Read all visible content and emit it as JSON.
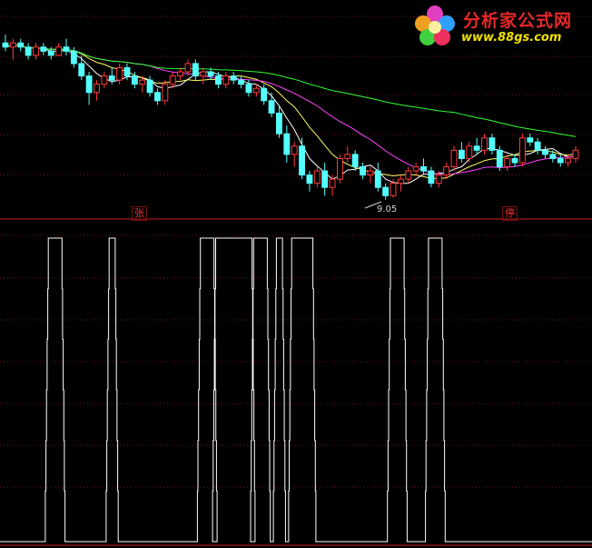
{
  "logo": {
    "brand": "分析家公式网",
    "url": "www.88gs.com"
  },
  "markers": {
    "rise": "张",
    "stop": "停"
  },
  "chart_data": [
    {
      "type": "candlestick",
      "panel": "top",
      "ylim": [
        8.6,
        13.4
      ],
      "colors": {
        "up": "#ff3b3b",
        "down": "#54ffff",
        "ma5": "#ffffff",
        "ma10": "#ffff66",
        "ma20": "#ff44ff",
        "ma60": "#33ff33"
      },
      "price_note": "9.05",
      "ohlc": [
        [
          12.8,
          13.0,
          12.6,
          12.7
        ],
        [
          12.7,
          12.9,
          12.4,
          12.8
        ],
        [
          12.8,
          12.9,
          12.6,
          12.7
        ],
        [
          12.7,
          12.8,
          12.4,
          12.5
        ],
        [
          12.5,
          12.8,
          12.4,
          12.7
        ],
        [
          12.7,
          12.8,
          12.5,
          12.6
        ],
        [
          12.6,
          12.7,
          12.4,
          12.5
        ],
        [
          12.5,
          12.8,
          12.5,
          12.7
        ],
        [
          12.7,
          12.9,
          12.5,
          12.6
        ],
        [
          12.6,
          12.7,
          12.2,
          12.3
        ],
        [
          12.3,
          12.5,
          11.9,
          12.0
        ],
        [
          12.0,
          12.1,
          11.3,
          11.6
        ],
        [
          11.6,
          11.9,
          11.4,
          11.8
        ],
        [
          11.8,
          12.1,
          11.7,
          12.0
        ],
        [
          12.0,
          12.2,
          11.8,
          11.9
        ],
        [
          11.9,
          12.3,
          11.8,
          12.2
        ],
        [
          12.2,
          12.3,
          11.9,
          12.0
        ],
        [
          12.0,
          12.1,
          11.7,
          11.8
        ],
        [
          11.8,
          12.0,
          11.6,
          11.9
        ],
        [
          11.9,
          12.0,
          11.5,
          11.6
        ],
        [
          11.6,
          11.7,
          11.3,
          11.4
        ],
        [
          11.4,
          11.9,
          11.3,
          11.8
        ],
        [
          11.8,
          12.1,
          11.7,
          12.0
        ],
        [
          12.0,
          12.2,
          11.9,
          12.1
        ],
        [
          12.1,
          12.4,
          12.0,
          12.3
        ],
        [
          12.3,
          12.4,
          11.9,
          12.0
        ],
        [
          12.0,
          12.2,
          11.8,
          12.1
        ],
        [
          12.1,
          12.2,
          11.9,
          12.0
        ],
        [
          12.0,
          12.1,
          11.7,
          11.8
        ],
        [
          11.8,
          12.1,
          11.7,
          12.0
        ],
        [
          12.0,
          12.1,
          11.8,
          11.9
        ],
        [
          11.9,
          12.0,
          11.7,
          11.8
        ],
        [
          11.8,
          11.9,
          11.5,
          11.6
        ],
        [
          11.6,
          11.8,
          11.5,
          11.7
        ],
        [
          11.7,
          11.8,
          11.3,
          11.4
        ],
        [
          11.4,
          11.6,
          11.0,
          11.1
        ],
        [
          11.1,
          11.3,
          10.5,
          10.6
        ],
        [
          10.6,
          10.8,
          9.9,
          10.1
        ],
        [
          10.1,
          10.4,
          9.8,
          10.3
        ],
        [
          10.3,
          10.5,
          9.5,
          9.6
        ],
        [
          9.6,
          9.7,
          9.2,
          9.4
        ],
        [
          9.4,
          9.8,
          9.3,
          9.7
        ],
        [
          9.7,
          9.9,
          9.1,
          9.3
        ],
        [
          9.3,
          9.6,
          9.1,
          9.5
        ],
        [
          9.5,
          10.1,
          9.4,
          10.0
        ],
        [
          10.0,
          10.3,
          9.9,
          10.1
        ],
        [
          10.1,
          10.2,
          9.7,
          9.8
        ],
        [
          9.8,
          9.9,
          9.5,
          9.6
        ],
        [
          9.6,
          9.8,
          9.4,
          9.7
        ],
        [
          9.7,
          9.9,
          9.2,
          9.3
        ],
        [
          9.3,
          9.4,
          9.0,
          9.1
        ],
        [
          9.1,
          9.5,
          9.05,
          9.4
        ],
        [
          9.4,
          9.6,
          9.2,
          9.5
        ],
        [
          9.5,
          9.8,
          9.4,
          9.7
        ],
        [
          9.7,
          9.9,
          9.6,
          9.8
        ],
        [
          9.8,
          10.0,
          9.6,
          9.7
        ],
        [
          9.7,
          9.8,
          9.3,
          9.4
        ],
        [
          9.4,
          9.7,
          9.3,
          9.6
        ],
        [
          9.6,
          9.9,
          9.5,
          9.8
        ],
        [
          9.8,
          10.3,
          9.7,
          10.2
        ],
        [
          10.2,
          10.4,
          9.9,
          10.0
        ],
        [
          10.0,
          10.4,
          9.9,
          10.3
        ],
        [
          10.3,
          10.5,
          10.1,
          10.2
        ],
        [
          10.2,
          10.6,
          10.1,
          10.5
        ],
        [
          10.5,
          10.6,
          10.1,
          10.2
        ],
        [
          10.2,
          10.3,
          9.7,
          9.8
        ],
        [
          9.8,
          10.1,
          9.7,
          10.0
        ],
        [
          10.0,
          10.1,
          9.8,
          9.9
        ],
        [
          9.9,
          10.6,
          9.8,
          10.5
        ],
        [
          10.5,
          10.6,
          10.3,
          10.4
        ],
        [
          10.4,
          10.5,
          10.1,
          10.2
        ],
        [
          10.2,
          10.3,
          10.0,
          10.1
        ],
        [
          10.1,
          10.2,
          9.9,
          10.0
        ],
        [
          10.0,
          10.1,
          9.8,
          9.9
        ],
        [
          9.9,
          10.1,
          9.8,
          10.0
        ],
        [
          10.0,
          10.3,
          9.9,
          10.2
        ]
      ]
    },
    {
      "type": "line",
      "panel": "bottom",
      "ylim": [
        0,
        100
      ],
      "color": "#ffffff",
      "values": [
        0,
        0,
        0,
        0,
        0,
        0,
        0,
        0,
        0,
        0,
        0,
        0,
        0,
        0,
        0,
        0,
        0,
        0,
        0,
        0,
        0,
        0,
        0,
        0,
        0,
        0,
        0,
        0,
        0,
        0,
        0,
        0,
        0,
        0,
        0,
        0,
        0,
        0,
        0,
        0,
        0,
        0,
        0,
        0,
        0,
        0,
        0,
        0,
        0,
        0,
        0,
        0,
        0,
        0,
        0,
        0,
        0,
        0,
        0,
        0,
        0,
        0,
        0,
        0,
        0,
        0,
        0,
        0,
        0,
        0,
        0,
        0,
        0,
        0,
        0,
        0,
        0,
        0,
        0,
        0,
        0,
        0,
        0,
        0,
        0,
        0,
        0,
        0,
        0,
        0,
        0,
        0,
        0,
        0,
        0,
        0,
        0,
        0,
        0,
        0,
        0,
        0,
        0,
        0,
        0,
        0,
        0,
        0,
        0,
        0,
        0,
        0,
        0,
        0,
        0,
        0,
        0,
        0,
        0,
        0,
        0,
        0,
        0,
        0,
        0,
        0,
        0,
        0,
        0,
        0,
        0,
        0,
        0,
        0,
        0,
        0,
        0,
        0,
        0,
        0,
        0,
        0,
        0,
        0,
        0,
        0,
        0,
        0,
        0,
        0,
        0,
        0,
        0,
        0,
        0,
        0,
        0,
        0,
        0,
        0,
        0,
        0,
        0,
        0,
        0,
        0,
        0,
        0,
        0,
        0,
        0,
        0,
        0,
        0,
        0,
        0,
        0,
        0,
        0,
        0,
        0,
        0,
        0,
        0,
        0,
        0,
        0,
        0,
        0,
        0,
        0,
        0,
        0,
        0,
        0,
        0,
        0,
        0,
        0,
        0,
        0,
        0,
        0,
        0,
        0,
        0,
        0,
        0,
        0,
        0,
        0,
        0,
        0,
        0,
        0,
        0,
        0,
        0,
        0,
        0,
        0,
        0,
        0,
        0,
        0,
        0,
        0,
        0,
        0,
        0,
        0,
        0,
        0,
        0,
        0,
        0,
        0,
        0,
        0,
        0,
        0,
        0,
        0,
        0,
        0,
        0,
        0,
        0,
        0,
        0,
        0,
        0,
        0,
        0,
        0,
        0,
        0,
        0,
        0,
        0,
        0,
        0,
        0,
        0,
        0,
        0,
        0,
        0,
        0,
        0,
        0,
        0,
        0,
        0,
        0,
        0,
        0,
        0,
        0,
        0,
        0,
        0,
        0,
        0,
        0,
        0,
        0,
        0,
        0,
        0,
        0,
        0,
        0,
        0,
        0,
        0,
        0,
        0,
        0,
        0,
        0,
        0,
        0,
        0,
        0,
        0,
        0,
        0,
        0,
        0,
        0,
        0,
        0,
        0,
        0,
        0,
        0,
        0,
        0,
        0,
        0,
        0,
        0,
        0,
        0,
        0,
        0,
        0,
        0,
        0,
        0,
        0,
        0,
        0,
        0,
        0,
        0,
        0,
        0,
        0,
        0,
        0,
        0,
        0,
        0,
        0,
        0,
        0,
        0,
        0,
        0,
        0,
        0,
        0,
        0,
        0,
        0,
        0,
        0,
        0,
        0,
        0,
        0,
        0,
        0,
        0,
        0,
        0,
        0,
        0,
        0,
        0,
        0,
        0,
        0,
        0,
        0,
        0,
        0,
        0,
        0,
        0,
        0,
        0,
        0,
        0,
        0,
        0,
        0,
        0,
        0,
        0,
        0,
        0,
        0,
        0,
        0,
        0,
        0,
        0,
        0,
        0,
        0,
        0,
        0,
        0,
        0,
        0,
        0,
        0,
        0,
        0,
        0,
        0,
        0,
        0,
        0,
        0,
        0,
        0,
        0,
        0,
        0,
        0,
        0,
        0,
        0,
        0,
        0,
        0,
        0,
        0,
        0,
        0,
        0,
        0,
        0,
        0,
        0,
        0,
        0,
        0,
        0,
        0,
        0,
        0,
        0,
        0,
        0,
        0,
        0,
        0,
        0,
        0,
        0,
        0,
        0,
        0,
        0,
        0,
        0,
        0,
        0,
        0,
        0,
        0,
        0,
        0,
        0,
        0,
        0,
        0,
        0,
        0,
        0,
        0,
        0,
        0,
        0,
        0,
        0,
        0,
        0,
        0,
        0,
        0,
        0,
        0,
        0,
        0,
        0,
        0,
        0,
        0,
        0,
        0,
        0,
        0,
        0,
        0,
        0,
        0,
        0,
        0,
        0,
        0,
        0,
        0,
        0,
        0,
        0,
        0,
        0,
        0,
        0,
        0,
        0,
        0,
        0,
        0,
        0,
        0,
        0,
        0,
        0,
        0,
        0,
        0,
        0,
        0,
        0,
        0,
        0,
        0,
        0,
        0,
        0,
        0,
        0,
        0,
        0,
        0,
        0,
        0,
        0,
        0,
        0,
        0,
        0,
        0,
        0,
        0,
        0,
        0,
        0,
        0,
        0,
        0,
        0,
        0,
        0,
        0,
        0,
        0,
        0,
        0,
        0,
        0,
        0,
        0,
        0,
        0,
        0,
        0,
        0,
        0,
        0,
        0,
        0,
        0,
        0,
        0,
        0,
        0,
        0,
        0,
        0,
        0,
        0,
        0,
        0,
        0,
        0,
        0,
        0,
        0,
        0,
        0,
        0,
        0,
        0,
        0,
        0,
        0,
        0,
        0,
        0,
        0,
        0,
        0,
        0,
        0,
        0,
        0,
        0,
        0,
        0,
        0,
        0,
        0,
        0,
        0,
        0,
        0,
        0,
        0,
        0,
        0,
        0,
        0,
        0,
        0,
        0,
        0,
        0,
        0,
        0,
        0,
        0,
        0,
        0,
        0,
        0,
        0,
        0,
        0,
        0,
        0,
        0,
        0,
        0,
        0,
        0,
        0,
        0,
        0,
        0,
        0,
        0,
        0,
        0,
        0,
        0,
        0,
        0,
        0,
        0,
        0,
        0,
        0,
        0,
        0,
        0,
        0,
        0,
        0,
        0,
        0,
        0,
        0,
        0,
        0,
        0,
        0,
        0,
        0,
        0,
        0,
        0,
        0,
        0,
        0,
        0,
        0,
        0,
        0,
        0,
        0,
        0,
        0,
        0,
        0,
        0,
        0,
        0,
        0,
        0,
        0,
        0
      ],
      "pulses": [
        [
          6,
          7
        ],
        [
          14,
          14
        ],
        [
          26,
          27
        ],
        [
          28,
          32
        ],
        [
          33,
          34
        ],
        [
          36,
          36
        ],
        [
          38,
          40
        ],
        [
          51,
          52
        ],
        [
          56,
          57
        ]
      ]
    }
  ]
}
